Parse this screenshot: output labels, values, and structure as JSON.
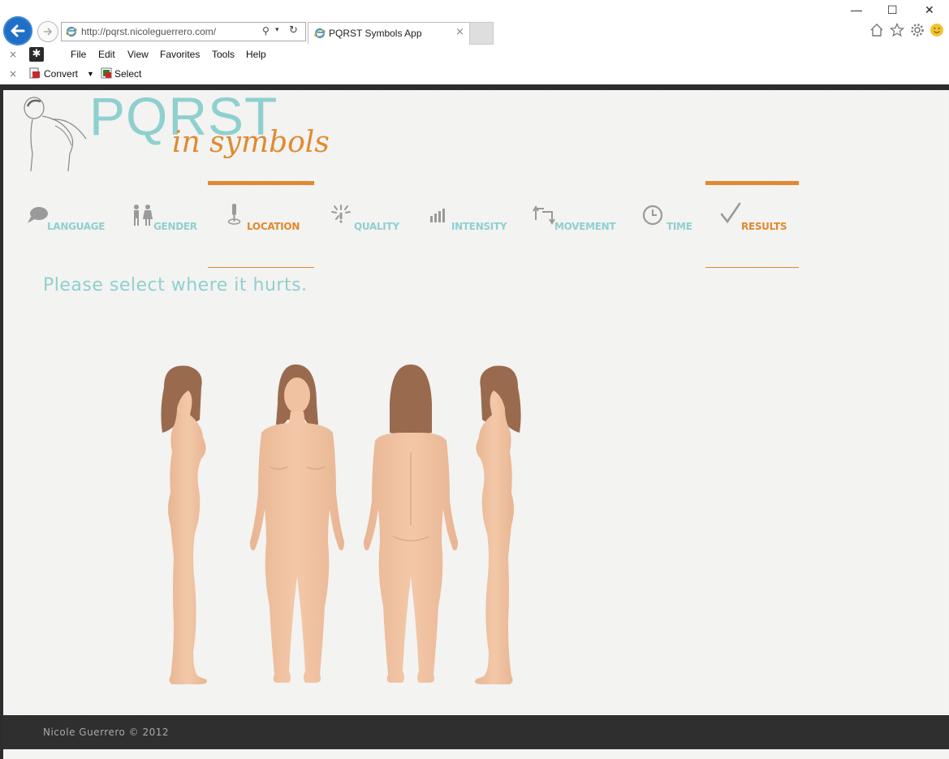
{
  "browser": {
    "url": "http://pqrst.nicoleguerrero.com/",
    "tab_title": "PQRST Symbols App",
    "tab_close": "×",
    "window_controls": {
      "minimize": "—",
      "maximize": "☐",
      "close": "✕"
    },
    "menu": [
      "File",
      "Edit",
      "View",
      "Favorites",
      "Tools",
      "Help"
    ],
    "command_bar": {
      "convert": "Convert",
      "select": "Select"
    },
    "close_glyph": "×",
    "addon_glyph": "✱",
    "icons": [
      "back-arrow-icon",
      "forward-arrow-icon",
      "ie-logo-icon",
      "search-icon",
      "refresh-icon",
      "home-icon",
      "favorites-star-icon",
      "settings-gear-icon",
      "smiley-icon"
    ]
  },
  "app": {
    "logo_title": "PQRST",
    "logo_tagline": "in symbols",
    "nav": [
      {
        "label": "LANGUAGE",
        "icon": "speech-bubble-icon",
        "active": false
      },
      {
        "label": "GENDER",
        "icon": "gender-people-icon",
        "active": false
      },
      {
        "label": "LOCATION",
        "icon": "pin-icon",
        "active": true
      },
      {
        "label": "QUALITY",
        "icon": "burst-icon",
        "active": false
      },
      {
        "label": "INTENSITY",
        "icon": "bars-icon",
        "active": false
      },
      {
        "label": "MOVEMENT",
        "icon": "arrows-icon",
        "active": false
      },
      {
        "label": "TIME",
        "icon": "clock-icon",
        "active": false
      },
      {
        "label": "RESULTS",
        "icon": "checkmark-icon",
        "active": true
      }
    ],
    "prompt": "Please select where it hurts.",
    "body_views": [
      "left-side",
      "front",
      "back",
      "right-side"
    ],
    "colors": {
      "teal": "#8fd0cf",
      "orange": "#e08a30",
      "skin": "#f0c2a2",
      "hair": "#9a6a4e",
      "footer": "#2f2f2f"
    }
  },
  "footer": {
    "text": "Nicole Guerrero © 2012"
  }
}
